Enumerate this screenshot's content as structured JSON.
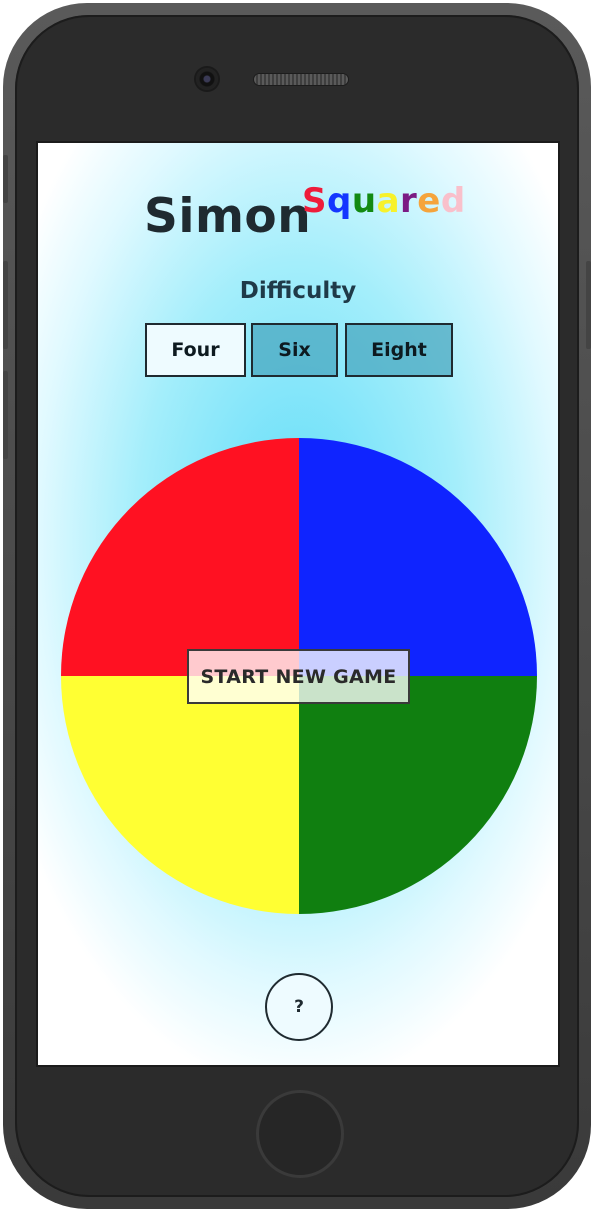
{
  "app": {
    "title_main": "Simon",
    "title_sup_letters": [
      {
        "ch": "S",
        "color": "#ee1c3a"
      },
      {
        "ch": "q",
        "color": "#1436ff"
      },
      {
        "ch": "u",
        "color": "#138a12"
      },
      {
        "ch": "a",
        "color": "#f7f12b"
      },
      {
        "ch": "r",
        "color": "#7b1b84"
      },
      {
        "ch": "e",
        "color": "#f5a43c"
      },
      {
        "ch": "d",
        "color": "#f9c0cb"
      }
    ]
  },
  "difficulty": {
    "label": "Difficulty",
    "options": [
      {
        "label": "Four",
        "selected": true
      },
      {
        "label": "Six",
        "selected": false
      },
      {
        "label": "Eight",
        "selected": false
      }
    ]
  },
  "board": {
    "quadrants": [
      {
        "name": "red",
        "color": "#ff1122"
      },
      {
        "name": "blue",
        "color": "#0f24ff"
      },
      {
        "name": "yellow",
        "color": "#ffff33"
      },
      {
        "name": "green",
        "color": "#107f10"
      }
    ]
  },
  "start_button": {
    "label": "START NEW GAME"
  },
  "help_button": {
    "label": "?"
  }
}
